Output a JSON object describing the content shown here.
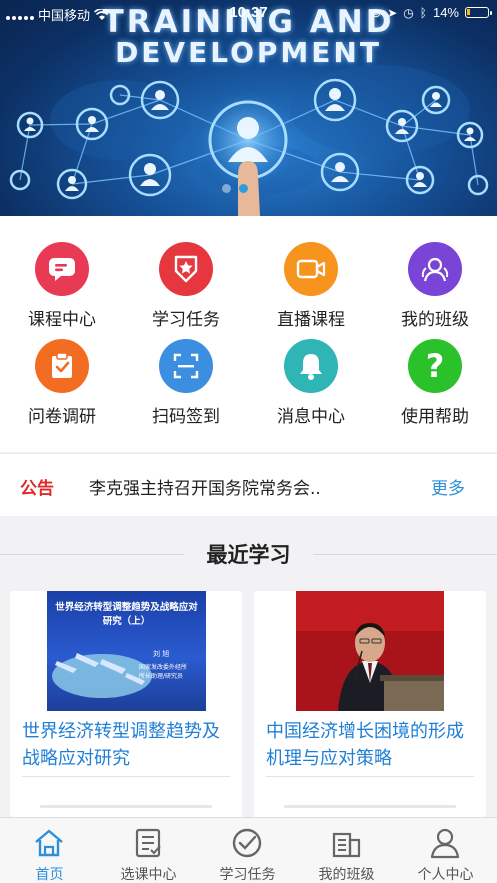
{
  "status_bar": {
    "carrier": "中国移动",
    "time": "10:37",
    "battery": "14%"
  },
  "banner": {
    "line1": "TRAINING AND",
    "line2": "DEVELOPMENT",
    "active_dot": 1,
    "dot_count": 2
  },
  "menu": {
    "items": [
      {
        "label": "课程中心",
        "icon": "course-chat-icon",
        "color": "#e83a55"
      },
      {
        "label": "学习任务",
        "icon": "star-badge-icon",
        "color": "#e5373d"
      },
      {
        "label": "直播课程",
        "icon": "video-camera-icon",
        "color": "#f7941d"
      },
      {
        "label": "我的班级",
        "icon": "group-people-icon",
        "color": "#7a44d6"
      },
      {
        "label": "问卷调研",
        "icon": "clipboard-check-icon",
        "color": "#f26d21"
      },
      {
        "label": "扫码签到",
        "icon": "scan-icon",
        "color": "#3c8fe0"
      },
      {
        "label": "消息中心",
        "icon": "bell-icon",
        "color": "#2fb5b5"
      },
      {
        "label": "使用帮助",
        "icon": "help-question-icon",
        "color": "#2ac12a"
      }
    ]
  },
  "notice": {
    "tag": "公告",
    "text": "李克强主持召开国务院常务会..",
    "more": "更多"
  },
  "recent": {
    "title": "最近学习",
    "cards": [
      {
        "title": "世界经济转型调整趋势及战略应对研究",
        "thumb_heading": "世界经济转型调整趋势及战略应对研究（上）",
        "thumb_name": "刘 旭",
        "thumb_org1": "国家发改委外经所",
        "thumb_org2": "所长助理/研究员"
      },
      {
        "title": "中国经济增长困境的形成机理与应对策略"
      }
    ]
  },
  "tabbar": {
    "active": 0,
    "tabs": [
      {
        "label": "首页",
        "icon": "home-icon"
      },
      {
        "label": "选课中心",
        "icon": "course-list-icon"
      },
      {
        "label": "学习任务",
        "icon": "check-circle-icon"
      },
      {
        "label": "我的班级",
        "icon": "class-building-icon"
      },
      {
        "label": "个人中心",
        "icon": "person-icon"
      }
    ]
  },
  "colors": {
    "accent": "#2d8fd8",
    "notice_tag": "#e02a2a",
    "card_title": "#1f7fd6"
  }
}
